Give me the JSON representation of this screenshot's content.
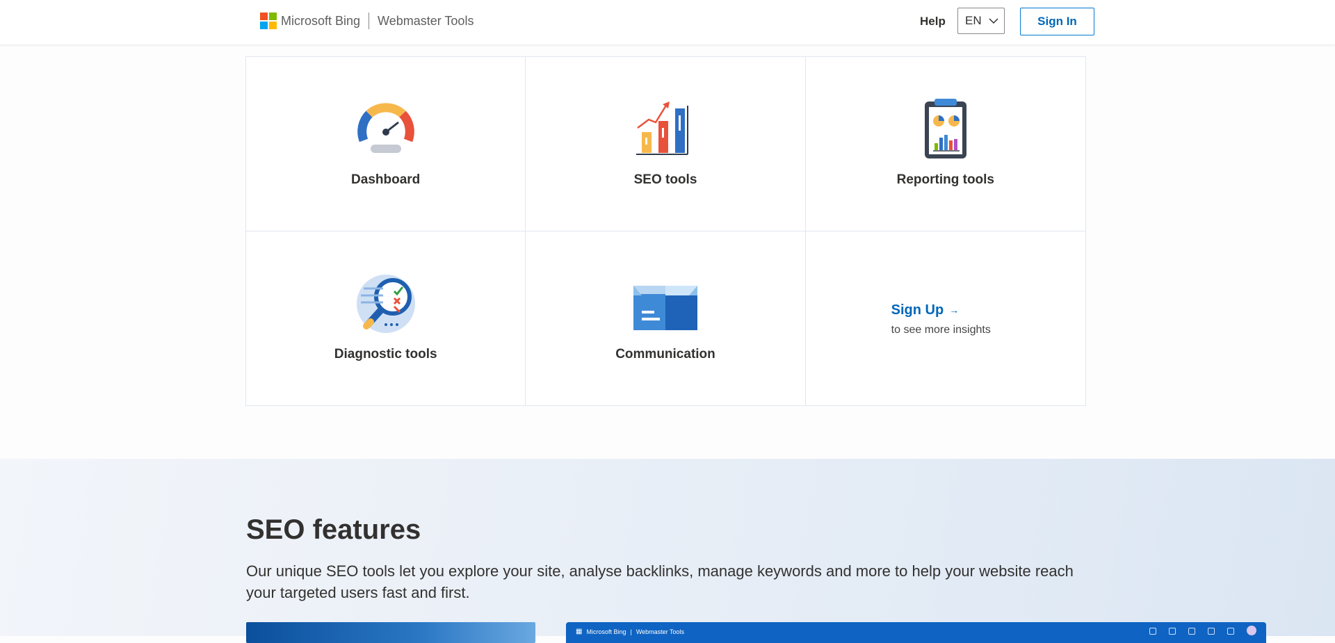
{
  "header": {
    "brand_name": "Microsoft Bing",
    "product_name": "Webmaster Tools",
    "help_label": "Help",
    "language_selected": "EN",
    "signin_label": "Sign In"
  },
  "tools": [
    {
      "label": "Dashboard",
      "icon": "speedometer-icon"
    },
    {
      "label": "SEO tools",
      "icon": "bar-chart-trend-icon"
    },
    {
      "label": "Reporting tools",
      "icon": "clipboard-report-icon"
    },
    {
      "label": "Diagnostic tools",
      "icon": "magnifier-checklist-icon"
    },
    {
      "label": "Communication",
      "icon": "inbox-tray-icon"
    }
  ],
  "signup": {
    "link_label": "Sign Up",
    "arrow": "→",
    "subtitle": "to see more insights"
  },
  "features": {
    "heading": "SEO features",
    "description": "Our unique SEO tools let you explore your site, analyse backlinks, manage keywords and more to help your website reach your targeted users fast and first.",
    "preview_brand": "Microsoft Bing",
    "preview_product": "Webmaster Tools"
  },
  "colors": {
    "accent": "#0067b8",
    "ms_red": "#f25022",
    "ms_green": "#7fba00",
    "ms_blue": "#00a4ef",
    "ms_yellow": "#ffb900"
  }
}
